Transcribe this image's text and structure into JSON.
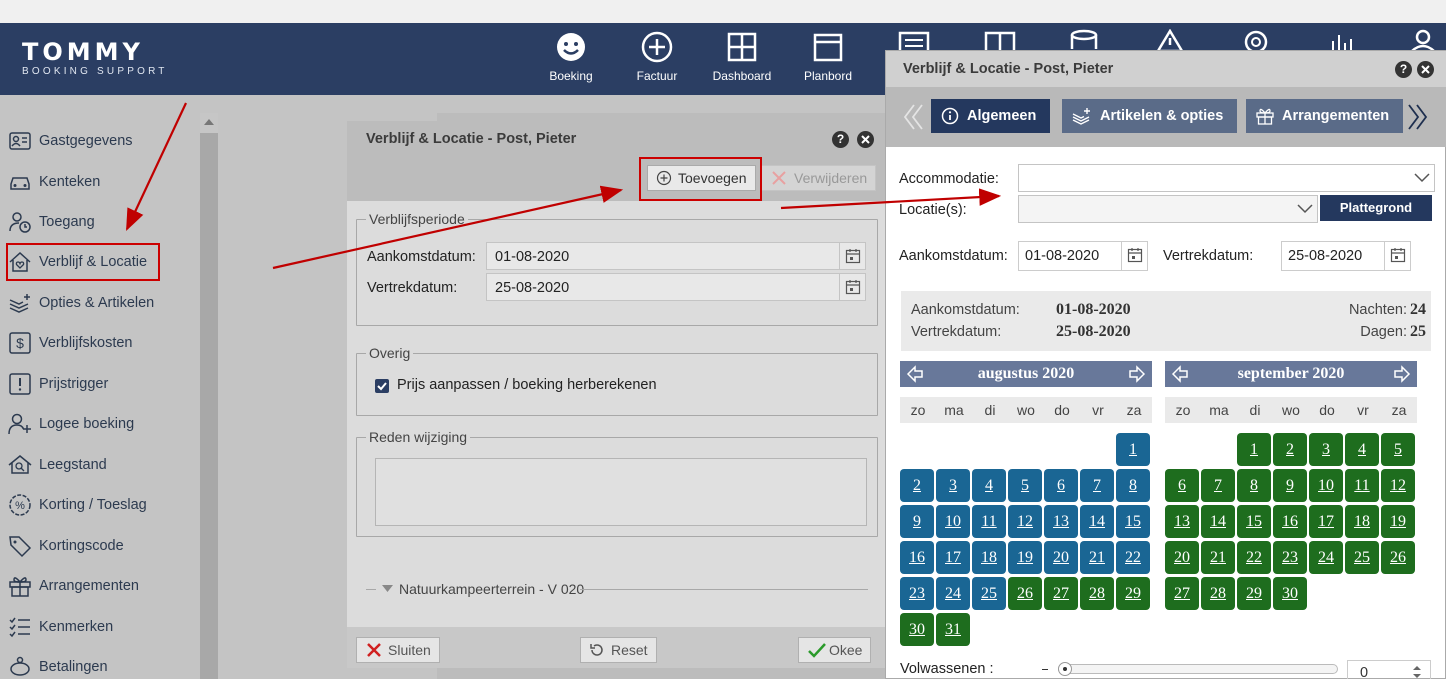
{
  "app": {
    "logo_main": "TOMMY",
    "logo_sub": "BOOKING SUPPORT"
  },
  "nav": [
    {
      "label": "Boeking",
      "icon": "smiley-icon"
    },
    {
      "label": "Factuur",
      "icon": "plus-circle-icon"
    },
    {
      "label": "Dashboard",
      "icon": "grid-icon"
    },
    {
      "label": "Planbord",
      "icon": "window-icon"
    }
  ],
  "sidebar": {
    "items": [
      {
        "label": "Gastgegevens",
        "icon": "id-card-icon"
      },
      {
        "label": "Kenteken",
        "icon": "car-icon"
      },
      {
        "label": "Toegang",
        "icon": "user-clock-icon"
      },
      {
        "label": "Verblijf & Locatie",
        "icon": "house-heart-icon",
        "active": true
      },
      {
        "label": "Opties & Artikelen",
        "icon": "layers-plus-icon"
      },
      {
        "label": "Verblijfskosten",
        "icon": "dollar-box-icon"
      },
      {
        "label": "Prijstrigger",
        "icon": "exclamation-box-icon"
      },
      {
        "label": "Logee boeking",
        "icon": "user-plus-icon"
      },
      {
        "label": "Leegstand",
        "icon": "house-search-icon"
      },
      {
        "label": "Korting / Toeslag",
        "icon": "percent-badge-icon"
      },
      {
        "label": "Kortingscode",
        "icon": "tag-icon"
      },
      {
        "label": "Arrangementen",
        "icon": "gift-icon"
      },
      {
        "label": "Kenmerken",
        "icon": "checklist-icon"
      },
      {
        "label": "Betalingen",
        "icon": "piggy-bank-icon"
      }
    ]
  },
  "dialog1": {
    "title": "Verblijf & Locatie - Post, Pieter",
    "help": "?",
    "add_label": "Toevoegen",
    "delete_label": "Verwijderen",
    "period_legend": "Verblijfsperiode",
    "arrival_label": "Aankomstdatum:",
    "arrival_value": "01-08-2020",
    "departure_label": "Vertrekdatum:",
    "departure_value": "25-08-2020",
    "other_legend": "Overig",
    "recalc_label": "Prijs aanpassen / boeking herberekenen",
    "recalc_checked": true,
    "reason_legend": "Reden wijziging",
    "location_group": "Natuurkampeerterrein - V 020",
    "close_label": "Sluiten",
    "reset_label": "Reset",
    "ok_label": "Okee"
  },
  "dialog2": {
    "title": "Verblijf & Locatie - Post, Pieter",
    "help": "?",
    "tabs": [
      {
        "label": "Algemeen",
        "icon": "info-icon",
        "active": true
      },
      {
        "label": "Artikelen & opties",
        "icon": "layers-plus-icon"
      },
      {
        "label": "Arrangementen",
        "icon": "gift-icon"
      }
    ],
    "accommodation_label": "Accommodatie:",
    "accommodation_value": "",
    "locations_label": "Locatie(s):",
    "locations_value": "",
    "floorplan_label": "Plattegrond",
    "arrival_label": "Aankomstdatum:",
    "arrival_value": "01-08-2020",
    "departure_label": "Vertrekdatum:",
    "departure_value": "25-08-2020",
    "summary": {
      "arrival_label": "Aankomstdatum:",
      "arrival_value": "01-08-2020",
      "departure_label": "Vertrekdatum:",
      "departure_value": "25-08-2020",
      "nights_label": "Nachten:",
      "nights_value": "24",
      "days_label": "Dagen:",
      "days_value": "25"
    },
    "weekdays": [
      "zo",
      "ma",
      "di",
      "wo",
      "do",
      "vr",
      "za"
    ],
    "months": [
      {
        "name": "augustus 2020",
        "first_weekday": 6,
        "days": 31,
        "stay_until": 25,
        "stay_color": "#1a6694",
        "rest_color": "#1e6d1e"
      },
      {
        "name": "september 2020",
        "first_weekday": 2,
        "days": 30,
        "stay_until": 0,
        "stay_color": "#1a6694",
        "rest_color": "#1e6d1e"
      }
    ],
    "adults_label": "Volwassenen :",
    "adults_value": "0"
  },
  "colors": {
    "header": "#2b3e63",
    "annotation": "#c00000",
    "stay_day": "#1a6694",
    "free_day": "#1e6d1e"
  }
}
